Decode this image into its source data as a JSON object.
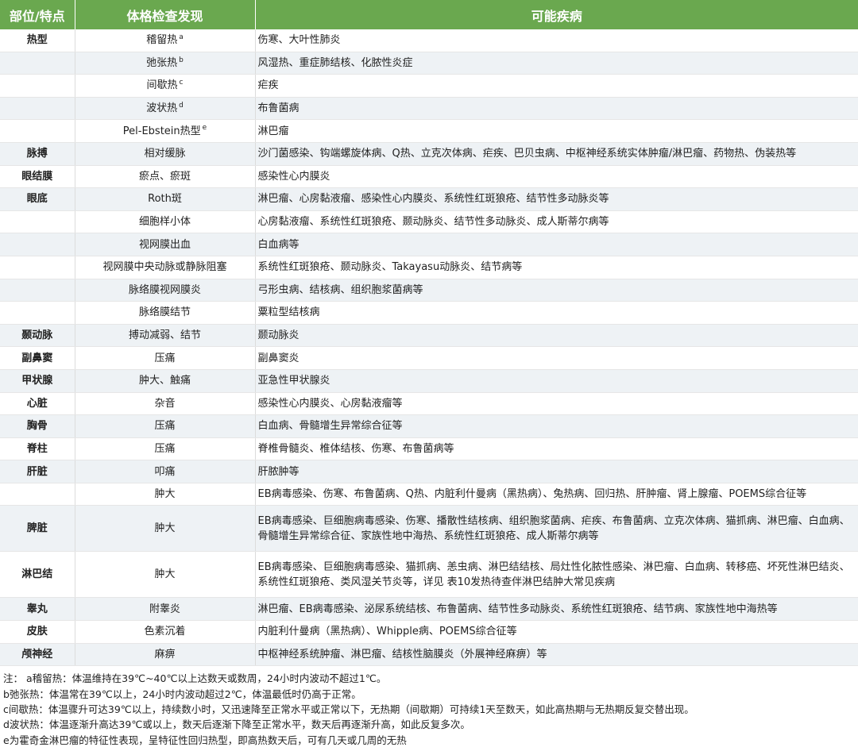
{
  "table": {
    "headers": [
      "部位/特点",
      "体格检查发现",
      "可能疾病"
    ],
    "rows": [
      {
        "part": "热型",
        "finding": "稽留热",
        "sup": "a",
        "disease": "伤寒、大叶性肺炎"
      },
      {
        "part": "",
        "finding": "弛张热",
        "sup": "b",
        "disease": "风湿热、重症肺结核、化脓性炎症"
      },
      {
        "part": "",
        "finding": "间歇热",
        "sup": "c",
        "disease": "疟疾"
      },
      {
        "part": "",
        "finding": "波状热",
        "sup": "d",
        "disease": "布鲁菌病"
      },
      {
        "part": "",
        "finding": "Pel-Ebstein热型",
        "sup": "e",
        "disease": "淋巴瘤"
      },
      {
        "part": "脉搏",
        "finding": "相对缓脉",
        "sup": "",
        "disease": "沙门菌感染、钩端螺旋体病、Q热、立克次体病、疟疾、巴贝虫病、中枢神经系统实体肿瘤/淋巴瘤、药物热、伪装热等"
      },
      {
        "part": "眼结膜",
        "finding": "瘀点、瘀斑",
        "sup": "",
        "disease": "感染性心内膜炎"
      },
      {
        "part": "眼底",
        "finding": "Roth斑",
        "sup": "",
        "disease": "淋巴瘤、心房黏液瘤、感染性心内膜炎、系统性红斑狼疮、结节性多动脉炎等"
      },
      {
        "part": "",
        "finding": "细胞样小体",
        "sup": "",
        "disease": "心房黏液瘤、系统性红斑狼疮、颞动脉炎、结节性多动脉炎、成人斯蒂尔病等"
      },
      {
        "part": "",
        "finding": "视网膜出血",
        "sup": "",
        "disease": "白血病等"
      },
      {
        "part": "",
        "finding": "视网膜中央动脉或静脉阻塞",
        "sup": "",
        "disease": "系统性红斑狼疮、颞动脉炎、Takayasu动脉炎、结节病等"
      },
      {
        "part": "",
        "finding": "脉络膜视网膜炎",
        "sup": "",
        "disease": "弓形虫病、结核病、组织胞浆菌病等"
      },
      {
        "part": "",
        "finding": "脉络膜结节",
        "sup": "",
        "disease": "粟粒型结核病"
      },
      {
        "part": "颞动脉",
        "finding": "搏动减弱、结节",
        "sup": "",
        "disease": "颞动脉炎"
      },
      {
        "part": "副鼻窦",
        "finding": "压痛",
        "sup": "",
        "disease": "副鼻窦炎"
      },
      {
        "part": "甲状腺",
        "finding": "肿大、触痛",
        "sup": "",
        "disease": "亚急性甲状腺炎"
      },
      {
        "part": "心脏",
        "finding": "杂音",
        "sup": "",
        "disease": "感染性心内膜炎、心房黏液瘤等"
      },
      {
        "part": "胸骨",
        "finding": "压痛",
        "sup": "",
        "disease": "白血病、骨髓增生异常综合征等"
      },
      {
        "part": "脊柱",
        "finding": "压痛",
        "sup": "",
        "disease": "脊椎骨髓炎、椎体结核、伤寒、布鲁菌病等"
      },
      {
        "part": "肝脏",
        "finding": "叩痛",
        "sup": "",
        "disease": "肝脓肿等"
      },
      {
        "part": "",
        "finding": "肿大",
        "sup": "",
        "disease": "EB病毒感染、伤寒、布鲁菌病、Q热、内脏利什曼病（黑热病）、兔热病、回归热、肝肿瘤、肾上腺瘤、POEMS综合征等"
      },
      {
        "part": "脾脏",
        "finding": "肿大",
        "sup": "",
        "disease": "EB病毒感染、巨细胞病毒感染、伤寒、播散性结核病、组织胞浆菌病、疟疾、布鲁菌病、立克次体病、猫抓病、淋巴瘤、白血病、骨髓增生异常综合征、家族性地中海热、系统性红斑狼疮、成人斯蒂尔病等",
        "tall": true
      },
      {
        "part": "淋巴结",
        "finding": "肿大",
        "sup": "",
        "disease": "EB病毒感染、巨细胞病毒感染、猫抓病、恙虫病、淋巴结结核、局灶性化脓性感染、淋巴瘤、白血病、转移癌、坏死性淋巴结炎、系统性红斑狼疮、类风湿关节炎等，详见 表10发热待查伴淋巴结肿大常见疾病",
        "tall": true
      },
      {
        "part": "睾丸",
        "finding": "附睾炎",
        "sup": "",
        "disease": "淋巴瘤、EB病毒感染、泌尿系统结核、布鲁菌病、结节性多动脉炎、系统性红斑狼疮、结节病、家族性地中海热等"
      },
      {
        "part": "皮肤",
        "finding": "色素沉着",
        "sup": "",
        "disease": "内脏利什曼病（黑热病）、Whipple病、POEMS综合征等"
      },
      {
        "part": "颅神经",
        "finding": "麻痹",
        "sup": "",
        "disease": "中枢神经系统肿瘤、淋巴瘤、结核性脑膜炎（外展神经麻痹）等"
      }
    ]
  },
  "notes": [
    "注：  a稽留热：体温维持在39℃~40℃以上达数天或数周，24小时内波动不超过1℃。",
    "b弛张热：体温常在39℃以上，24小时内波动超过2℃，体温最低时仍高于正常。",
    "c间歇热：体温骤升可达39℃以上，持续数小时，又迅速降至正常水平或正常以下，无热期（间歇期）可持续1天至数天，如此高热期与无热期反复交替出现。",
    "d波状热：体温逐渐升高达39℃或以上，数天后逐渐下降至正常水平，数天后再逐渐升高，如此反复多次。",
    "e为霍奇金淋巴瘤的特征性表现，呈特征性回归热型，即高热数天后，可有几天或几周的无热"
  ],
  "colors": {
    "header_bg": "#6aa84f",
    "row_alt_bg": "#eef2f5"
  }
}
